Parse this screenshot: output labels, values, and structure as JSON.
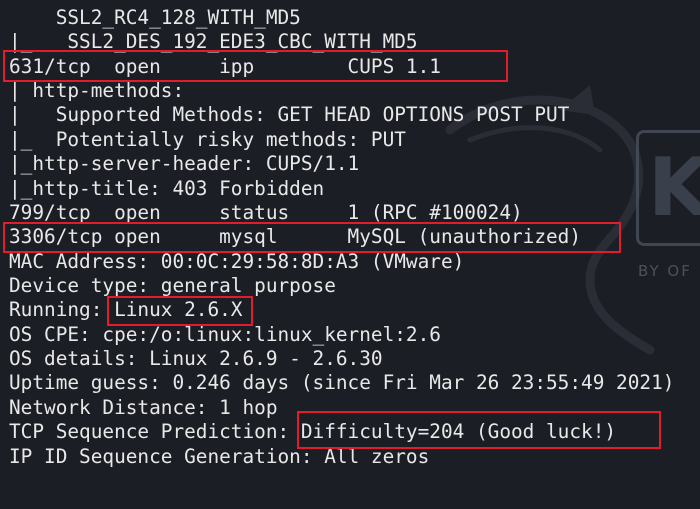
{
  "watermark": {
    "logo_letter": "K",
    "byline": "BY OF"
  },
  "output_lines": [
    "    SSL2_RC4_128_WITH_MD5",
    "|_   SSL2_DES_192_EDE3_CBC_WITH_MD5",
    "631/tcp  open     ipp        CUPS 1.1",
    "| http-methods:",
    "|   Supported Methods: GET HEAD OPTIONS POST PUT",
    "|_  Potentially risky methods: PUT",
    "|_http-server-header: CUPS/1.1",
    "|_http-title: 403 Forbidden",
    "799/tcp  open     status     1 (RPC #100024)",
    "3306/tcp open     mysql      MySQL (unauthorized)",
    "MAC Address: 00:0C:29:58:8D:A3 (VMware)",
    "Device type: general purpose",
    "Running: Linux 2.6.X",
    "OS CPE: cpe:/o:linux:linux_kernel:2.6",
    "OS details: Linux 2.6.9 - 2.6.30",
    "Uptime guess: 0.246 days (since Fri Mar 26 23:55:49 2021)",
    "Network Distance: 1 hop",
    "TCP Sequence Prediction: Difficulty=204 (Good luck!)",
    "IP ID Sequence Generation: All zeros"
  ],
  "highlight_color": "#e11d2b",
  "text_color": "#e8e8e8",
  "background_color": "#1c1e25"
}
